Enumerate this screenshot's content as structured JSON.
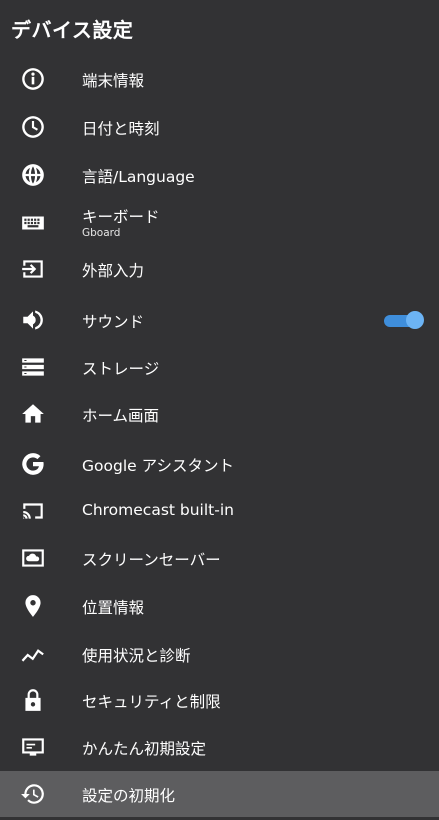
{
  "header": {
    "title": "デバイス設定"
  },
  "items": [
    {
      "label": "端末情報",
      "icon": "info-icon"
    },
    {
      "label": "日付と時刻",
      "icon": "clock-icon"
    },
    {
      "label": "言語/Language",
      "icon": "globe-icon"
    },
    {
      "label": "キーボード",
      "sub": "Gboard",
      "icon": "keyboard-icon"
    },
    {
      "label": "外部入力",
      "icon": "input-icon"
    },
    {
      "label": "サウンド",
      "icon": "speaker-icon",
      "toggle_on": true
    },
    {
      "label": "ストレージ",
      "icon": "storage-icon"
    },
    {
      "label": "ホーム画面",
      "icon": "home-icon"
    },
    {
      "label": "Google アシスタント",
      "icon": "google-icon"
    },
    {
      "label": "Chromecast built-in",
      "icon": "cast-icon"
    },
    {
      "label": "スクリーンセーバー",
      "icon": "screensaver-icon"
    },
    {
      "label": "位置情報",
      "icon": "location-pin-icon"
    },
    {
      "label": "使用状況と診断",
      "icon": "analytics-icon"
    },
    {
      "label": "セキュリティと制限",
      "icon": "lock-icon"
    },
    {
      "label": "かんたん初期設定",
      "icon": "tv-setup-icon"
    },
    {
      "label": "設定の初期化",
      "icon": "restore-icon",
      "selected": true
    }
  ],
  "colors": {
    "panel_bg": "#323234",
    "selected_bg": "#5d5d5f",
    "toggle_track": "#3f8edb",
    "toggle_knob": "#6cb4f5"
  }
}
